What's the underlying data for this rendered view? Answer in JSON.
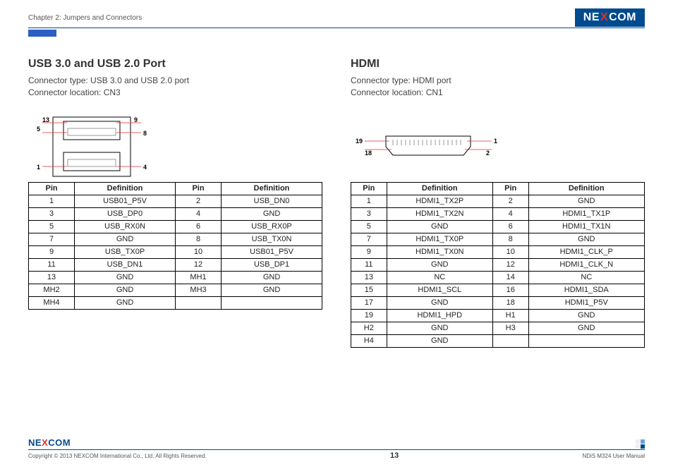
{
  "header": {
    "chapter": "Chapter 2: Jumpers and Connectors",
    "brand_pre": "NE",
    "brand_x": "X",
    "brand_post": "COM"
  },
  "left": {
    "title": "USB 3.0 and USB 2.0 Port",
    "line1": "Connector type: USB 3.0 and USB 2.0 port",
    "line2": "Connector location: CN3",
    "diagram_labels": {
      "a": "13",
      "b": "9",
      "c": "5",
      "d": "8",
      "e": "1",
      "f": "4"
    },
    "headers": [
      "Pin",
      "Definition",
      "Pin",
      "Definition"
    ],
    "rows": [
      [
        "1",
        "USB01_P5V",
        "2",
        "USB_DN0"
      ],
      [
        "3",
        "USB_DP0",
        "4",
        "GND"
      ],
      [
        "5",
        "USB_RX0N",
        "6",
        "USB_RX0P"
      ],
      [
        "7",
        "GND",
        "8",
        "USB_TX0N"
      ],
      [
        "9",
        "USB_TX0P",
        "10",
        "USB01_P5V"
      ],
      [
        "11",
        "USB_DN1",
        "12",
        "USB_DP1"
      ],
      [
        "13",
        "GND",
        "MH1",
        "GND"
      ],
      [
        "MH2",
        "GND",
        "MH3",
        "GND"
      ],
      [
        "MH4",
        "GND",
        "",
        ""
      ]
    ]
  },
  "right": {
    "title": "HDMI",
    "line1": "Connector type: HDMI port",
    "line2": "Connector location: CN1",
    "diagram_labels": {
      "a": "19",
      "b": "1",
      "c": "18",
      "d": "2"
    },
    "headers": [
      "Pin",
      "Definition",
      "Pin",
      "Definition"
    ],
    "rows": [
      [
        "1",
        "HDMI1_TX2P",
        "2",
        "GND"
      ],
      [
        "3",
        "HDMI1_TX2N",
        "4",
        "HDMI1_TX1P"
      ],
      [
        "5",
        "GND",
        "6",
        "HDMI1_TX1N"
      ],
      [
        "7",
        "HDMI1_TX0P",
        "8",
        "GND"
      ],
      [
        "9",
        "HDMI1_TX0N",
        "10",
        "HDMI1_CLK_P"
      ],
      [
        "11",
        "GND",
        "12",
        "HDMI1_CLK_N"
      ],
      [
        "13",
        "NC",
        "14",
        "NC"
      ],
      [
        "15",
        "HDMI1_SCL",
        "16",
        "HDMI1_SDA"
      ],
      [
        "17",
        "GND",
        "18",
        "HDMI1_P5V"
      ],
      [
        "19",
        "HDMI1_HPD",
        "H1",
        "GND"
      ],
      [
        "H2",
        "GND",
        "H3",
        "GND"
      ],
      [
        "H4",
        "GND",
        "",
        ""
      ]
    ]
  },
  "footer": {
    "copyright": "Copyright © 2013 NEXCOM International Co., Ltd. All Rights Reserved.",
    "page": "13",
    "manual": "NDiS M324 User Manual",
    "brand_pre": "NE",
    "brand_x": "X",
    "brand_post": "COM"
  }
}
